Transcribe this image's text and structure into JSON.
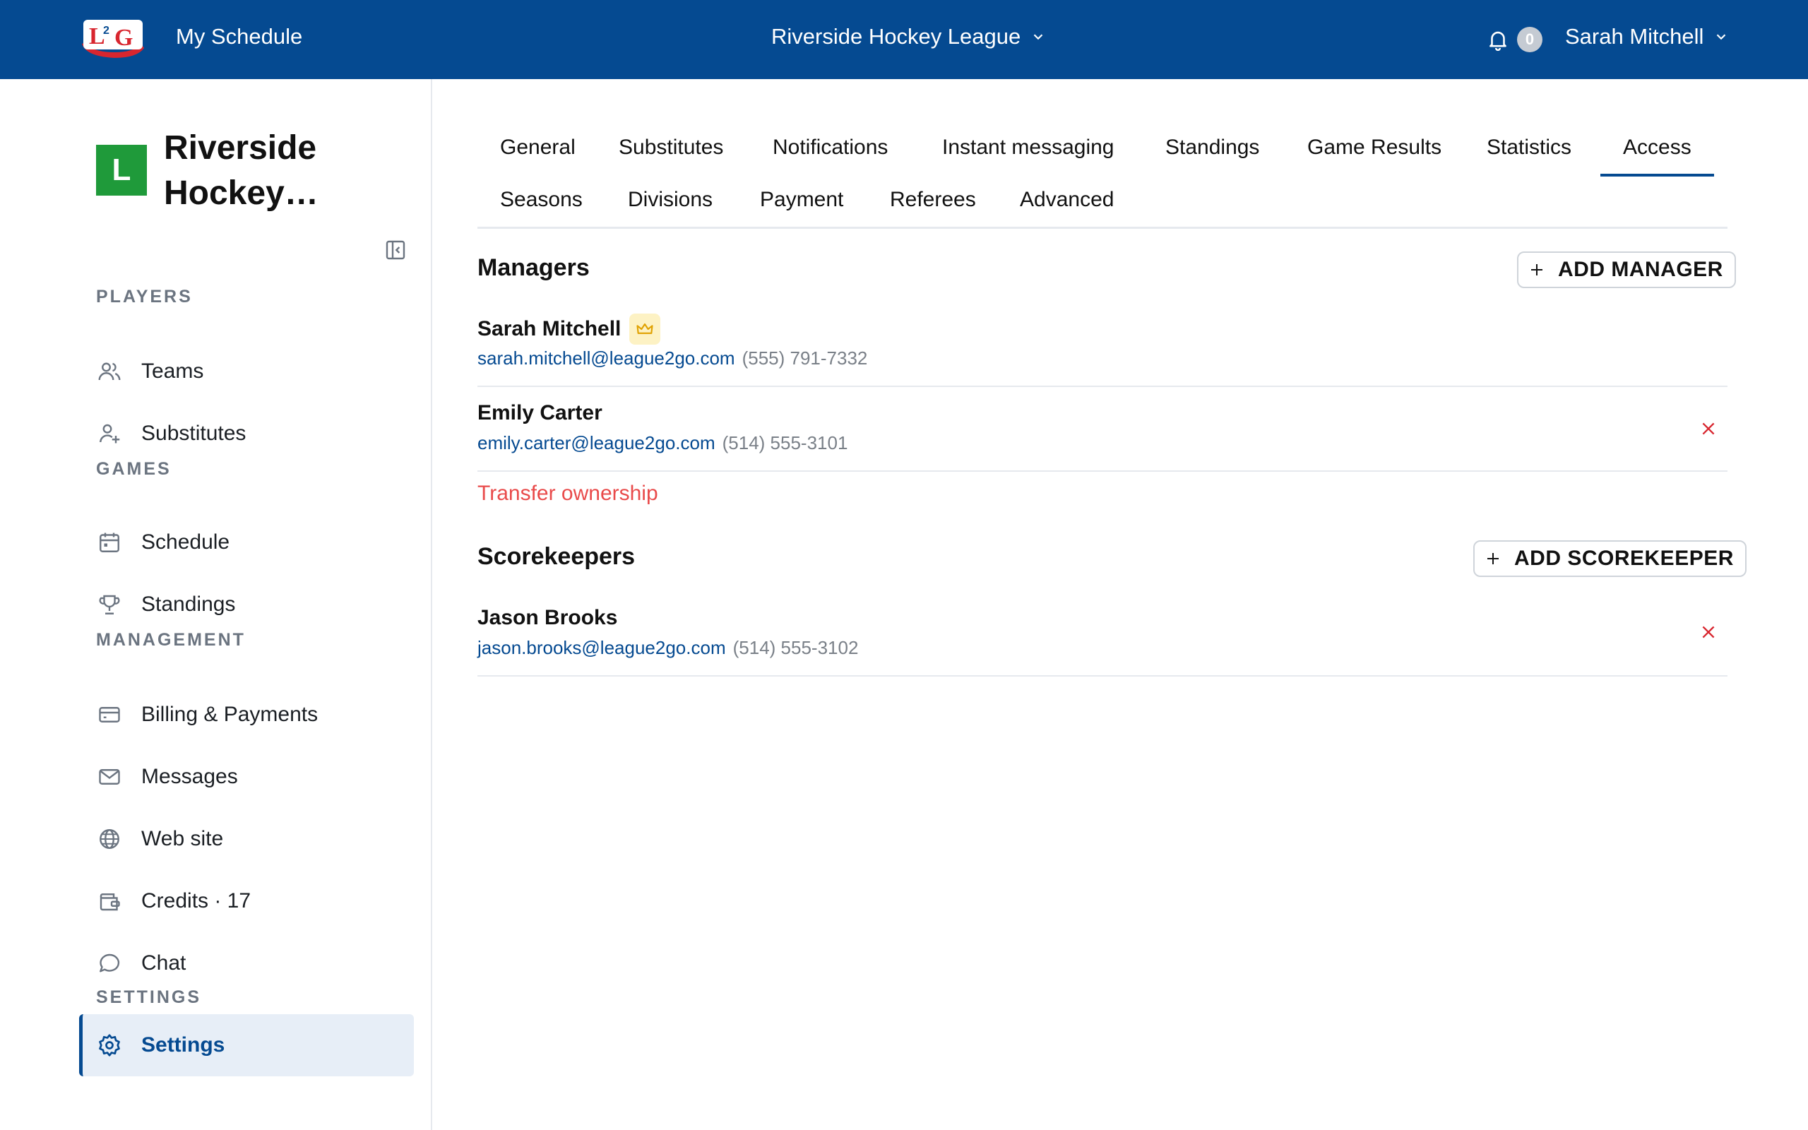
{
  "colors": {
    "brand": "#054a91",
    "league_avatar": "#1f9a3a",
    "danger": "#e94b4b",
    "crown_bg": "#fdf2c4"
  },
  "topbar": {
    "logo_icon": "l2g-logo",
    "my_schedule": "My Schedule",
    "league_name": "Riverside Hockey League",
    "notification_count": "0",
    "user_name": "Sarah Mitchell"
  },
  "sidebar": {
    "league_initial": "L",
    "league_title": "Riverside Hockey…",
    "sections": {
      "players": "PLAYERS",
      "games": "GAMES",
      "management": "MANAGEMENT",
      "settings": "SETTINGS"
    },
    "items": [
      {
        "label": "Teams",
        "icon": "users-icon"
      },
      {
        "label": "Substitutes",
        "icon": "user-plus-icon"
      },
      {
        "label": "Schedule",
        "icon": "calendar-icon"
      },
      {
        "label": "Standings",
        "icon": "trophy-icon"
      },
      {
        "label": "Billing & Payments",
        "icon": "credit-card-icon"
      },
      {
        "label": "Messages",
        "icon": "mail-icon"
      },
      {
        "label": "Web site",
        "icon": "globe-icon"
      },
      {
        "label": "Credits · 17",
        "icon": "wallet-icon"
      },
      {
        "label": "Chat",
        "icon": "chat-icon"
      },
      {
        "label": "Settings",
        "icon": "gear-icon",
        "active": true
      }
    ]
  },
  "tabs": [
    "General",
    "Substitutes",
    "Notifications",
    "Instant messaging",
    "Standings",
    "Game Results",
    "Statistics",
    "Access",
    "Seasons",
    "Divisions",
    "Payment",
    "Referees",
    "Advanced"
  ],
  "active_tab": "Access",
  "managers": {
    "title": "Managers",
    "add_label": "ADD MANAGER",
    "people": [
      {
        "name": "Sarah Mitchell",
        "email": "sarah.mitchell@league2go.com",
        "phone": "(555) 791-7332",
        "owner": true
      },
      {
        "name": "Emily Carter",
        "email": "emily.carter@league2go.com",
        "phone": "(514) 555-3101",
        "owner": false
      }
    ],
    "transfer_label": "Transfer ownership"
  },
  "scorekeepers": {
    "title": "Scorekeepers",
    "add_label": "ADD SCOREKEEPER",
    "people": [
      {
        "name": "Jason Brooks",
        "email": "jason.brooks@league2go.com",
        "phone": "(514) 555-3102"
      }
    ]
  }
}
